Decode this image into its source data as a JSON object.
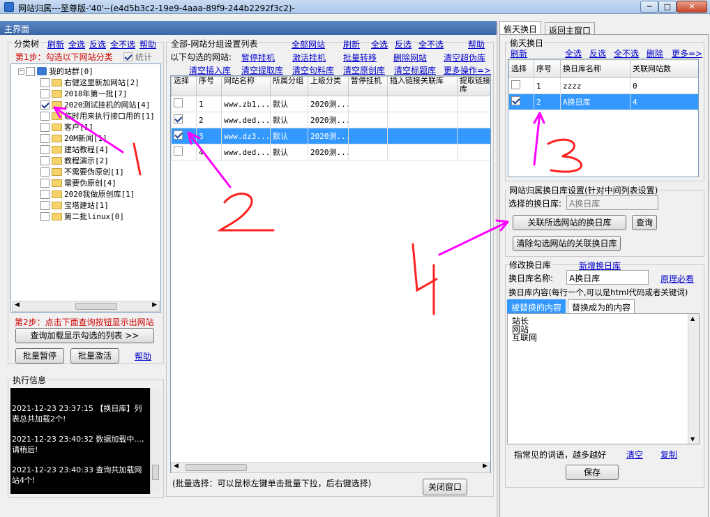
{
  "window": {
    "title": "网站归属---至尊版-'40'--(e4d5b3c2-19e9-4aaa-89f9-244b2292f3c2)-",
    "min": "─",
    "max": "□",
    "close": "✕"
  },
  "left_header": "主界面",
  "tree_panel": {
    "title": "分类树",
    "links": {
      "refresh": "刷新",
      "select_all": "全选",
      "invert": "反选",
      "select_none": "全不选",
      "help": "帮助"
    },
    "step1": "第1步：勾选以下网站分类",
    "stats_label": "统计",
    "root": "我的站群[0]",
    "nodes": [
      {
        "label": "右健这里新加网站[2]",
        "checked": false
      },
      {
        "label": "2018年第一批[7]",
        "checked": false
      },
      {
        "label": "2020测试挂机的网站[4]",
        "checked": true
      },
      {
        "label": "临时用来执行接口用的[1]",
        "checked": false
      },
      {
        "label": "客户[1]",
        "checked": false
      },
      {
        "label": "20M新闻[1]",
        "checked": false
      },
      {
        "label": "建站教程[4]",
        "checked": false
      },
      {
        "label": "教程演示[2]",
        "checked": false
      },
      {
        "label": "不需要伪原创[1]",
        "checked": false
      },
      {
        "label": "需要伪原创[4]",
        "checked": false
      },
      {
        "label": "2020我做原创库[1]",
        "checked": false
      },
      {
        "label": "宝塔建站[1]",
        "checked": false
      },
      {
        "label": "第二批linux[0]",
        "checked": false
      }
    ],
    "step2": "第2步：点击下面查询按钮显示出网站",
    "query_button": "查询加载显示勾选的列表 >>",
    "batch_pause": "批量暂停",
    "batch_activate": "批量激活",
    "help2": "帮助"
  },
  "log_panel": {
    "title": "执行信息",
    "lines": [
      "2021-12-23 23:37:15 【换日库】列表总共加载2个!",
      "2021-12-23 23:40:32 数据加载中...,请稍后!",
      "2021-12-23 23:40:33 查询共加载网站4个!"
    ]
  },
  "sites_panel": {
    "title": "全部-网站分组设置列表",
    "links_row1": {
      "all_sites": "全部网站",
      "refresh": "刷新",
      "select_all": "全选",
      "invert": "反选",
      "select_none": "全不选",
      "help": "帮助"
    },
    "checked_label": "以下勾选的网站:",
    "links_row2": [
      "暂停挂机",
      "激活挂机",
      "批量转移",
      "删除网站",
      "清空超伪库"
    ],
    "links_row3": [
      "清空插入库",
      "清空提取库",
      "清空句料库",
      "清空原创库",
      "清空标题库",
      "更多操作=>"
    ],
    "columns": [
      "选择",
      "序号",
      "网站名称",
      "所属分组",
      "上级分类",
      "暂停挂机",
      "插入链接关联库",
      "提取链接库"
    ],
    "rows": [
      {
        "checked": false,
        "no": "1",
        "name": "www.zb1...",
        "group": "默认",
        "parent": "2020测...",
        "selected": false
      },
      {
        "checked": true,
        "no": "2",
        "name": "www.ded...",
        "group": "默认",
        "parent": "2020测...",
        "selected": false
      },
      {
        "checked": true,
        "no": "3",
        "name": "www.dz3...",
        "group": "默认",
        "parent": "2020测...",
        "selected": true
      },
      {
        "checked": false,
        "no": "4",
        "name": "www.ded...",
        "group": "默认",
        "parent": "2020测...",
        "selected": false
      }
    ],
    "hint": "(批量选择：可以鼠标左键单击批量下拉，后右键选择)",
    "close_button": "关闭窗口"
  },
  "right_tabs": {
    "tab1": "偷天换日",
    "tab2": "返回主窗口"
  },
  "swap_panel": {
    "title": "偷天换日",
    "links": {
      "refresh": "刷新",
      "select_all": "全选",
      "invert": "反选",
      "select_none": "全不选",
      "delete": "删除",
      "more": "更多=>"
    },
    "columns": [
      "选择",
      "序号",
      "换日库名称",
      "关联网站数"
    ],
    "rows": [
      {
        "checked": false,
        "no": "1",
        "name": "zzzz",
        "count": "0",
        "selected": false
      },
      {
        "checked": true,
        "no": "2",
        "name": "A换日库",
        "count": "4",
        "selected": true
      }
    ]
  },
  "assign_panel": {
    "title": "网站归属换日库设置(针对中间列表设置)",
    "selected_label": "选择的换日库:",
    "selected_value": "A换日库",
    "link_button": "关联所选网站的换日库",
    "query_button": "查询",
    "clear_button": "清除勾选网站的关联换日库"
  },
  "edit_panel": {
    "title": "修改换日库",
    "new_link": "新增换日库",
    "name_label": "换日库名称:",
    "name_value": "A换日库",
    "principle_link": "原理必看",
    "content_label": "换日库内容(每行一个,可以是html代码或者关键词)",
    "tab_replaced": "被替换的内容",
    "tab_replace_with": "替换成为的内容",
    "lines": [
      "站长",
      "网站",
      "互联网"
    ],
    "tip": "指常见的词语，越多越好",
    "clear": "清空",
    "copy": "复制",
    "save_button": "保存"
  },
  "annotations": {
    "a1": "1",
    "a2": "2",
    "a3": "3",
    "a4": "4"
  },
  "colors": {
    "selection": "#3399ff",
    "annotation": "#ff2020",
    "arrow": "#ff00ff",
    "link": "#0000cc",
    "step_text": "#d00000"
  }
}
